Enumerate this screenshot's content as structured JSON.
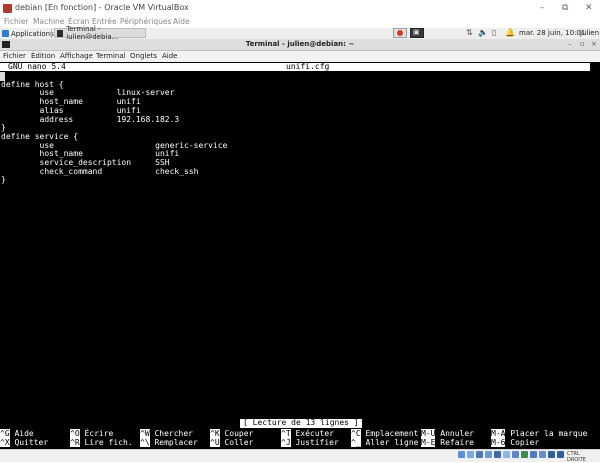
{
  "vbox": {
    "title": "debian [En fonction] - Oracle VM VirtualBox",
    "menu": [
      "Fichier",
      "Machine",
      "Écran",
      "Entrée",
      "Périphériques",
      "Aide"
    ],
    "host_key": "CTRL DROITE"
  },
  "panel": {
    "applications": "Applications :",
    "task": "Terminal - julien@debia...",
    "clock": "mar. 28 juin, 10:01",
    "user": "julien"
  },
  "terminal": {
    "title": "Terminal - julien@debian: ~",
    "menu": [
      "Fichier",
      "Édition",
      "Affichage",
      "Terminal",
      "Onglets",
      "Aide"
    ]
  },
  "nano": {
    "version": "GNU nano 5.4",
    "filename": "unifi.cfg",
    "lines": [
      "define host {",
      "        use             linux-server",
      "        host_name       unifi",
      "        alias           unifi",
      "        address         192.168.182.3",
      "}",
      "",
      "define service {",
      "        use                     generic-service",
      "        host_name               unifi",
      "        service_description     SSH",
      "        check_command           check_ssh",
      "}"
    ],
    "status": "[ Lecture de 13 lignes ]",
    "shortcuts_row1": [
      {
        "key": "^G",
        "label": "Aide"
      },
      {
        "key": "^O",
        "label": "Écrire"
      },
      {
        "key": "^W",
        "label": "Chercher"
      },
      {
        "key": "^K",
        "label": "Couper"
      },
      {
        "key": "^T",
        "label": "Exécuter"
      },
      {
        "key": "^C",
        "label": "Emplacement"
      },
      {
        "key": "M-U",
        "label": "Annuler"
      },
      {
        "key": "M-A",
        "label": "Placer la marque"
      }
    ],
    "shortcuts_row2": [
      {
        "key": "^X",
        "label": "Quitter"
      },
      {
        "key": "^R",
        "label": "Lire fich."
      },
      {
        "key": "^\\",
        "label": "Remplacer"
      },
      {
        "key": "^U",
        "label": "Coller"
      },
      {
        "key": "^J",
        "label": "Justifier"
      },
      {
        "key": "^_",
        "label": "Aller ligne"
      },
      {
        "key": "M-E",
        "label": "Refaire"
      },
      {
        "key": "M-6",
        "label": "Copier"
      }
    ]
  }
}
